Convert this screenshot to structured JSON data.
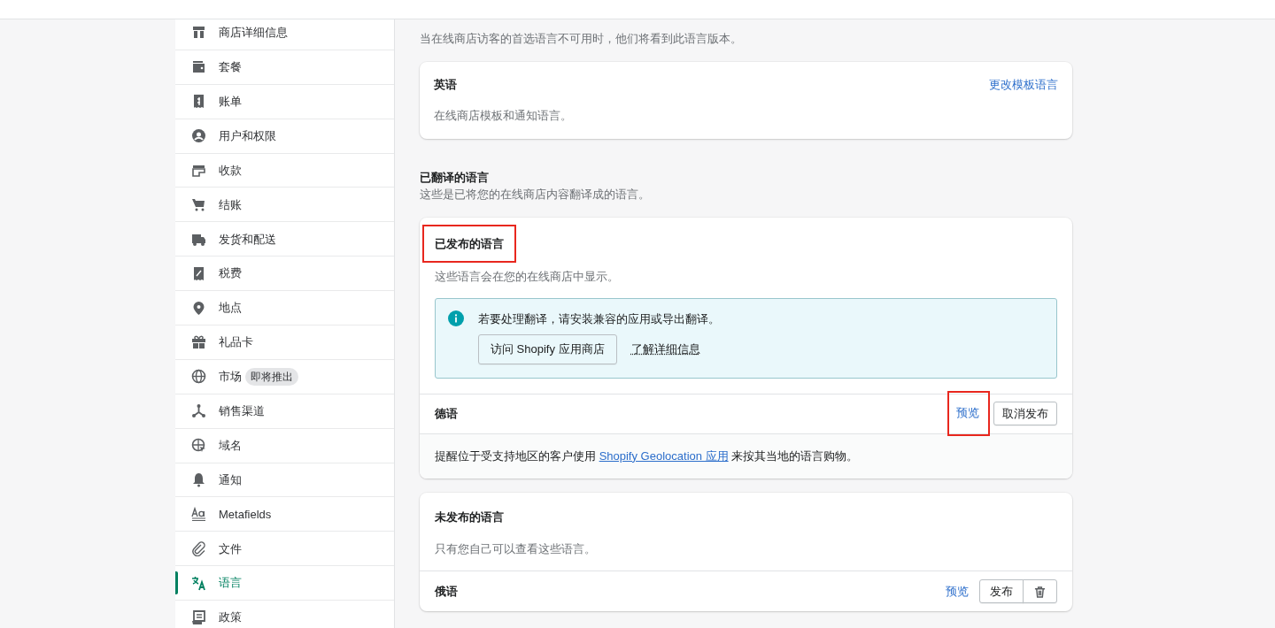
{
  "sidebar": {
    "items": [
      {
        "label": "商店详细信息",
        "selected": false
      },
      {
        "label": "套餐",
        "selected": false
      },
      {
        "label": "账单",
        "selected": false
      },
      {
        "label": "用户和权限",
        "selected": false
      },
      {
        "label": "收款",
        "selected": false
      },
      {
        "label": "结账",
        "selected": false
      },
      {
        "label": "发货和配送",
        "selected": false
      },
      {
        "label": "税费",
        "selected": false
      },
      {
        "label": "地点",
        "selected": false
      },
      {
        "label": "礼品卡",
        "selected": false
      },
      {
        "label": "市场",
        "selected": false,
        "badge": "即将推出"
      },
      {
        "label": "销售渠道",
        "selected": false
      },
      {
        "label": "域名",
        "selected": false
      },
      {
        "label": "通知",
        "selected": false
      },
      {
        "label": "Metafields",
        "selected": false
      },
      {
        "label": "文件",
        "selected": false
      },
      {
        "label": "语言",
        "selected": true
      },
      {
        "label": "政策",
        "selected": false
      }
    ]
  },
  "default_language": {
    "description": "当在线商店访客的首选语言不可用时，他们将看到此语言版本。",
    "card": {
      "name": "英语",
      "action": "更改模板语言",
      "note": "在线商店模板和通知语言。"
    }
  },
  "translated": {
    "title": "已翻译的语言",
    "description": "这些是已将您的在线商店内容翻译成的语言。",
    "published": {
      "title": "已发布的语言",
      "highlighted": true,
      "description": "这些语言会在您的在线商店中显示。",
      "banner": {
        "message": "若要处理翻译，请安装兼容的应用或导出翻译。",
        "button": "访问 Shopify 应用商店",
        "link": "了解详细信息"
      },
      "languages": [
        {
          "name": "德语",
          "preview": "预览",
          "preview_highlighted": true,
          "action": "取消发布",
          "note_before": "提醒位于受支持地区的客户使用 ",
          "note_link": "Shopify Geolocation 应用",
          "note_after": " 来按其当地的语言购物。"
        }
      ]
    },
    "unpublished": {
      "title": "未发布的语言",
      "description": "只有您自己可以查看这些语言。",
      "languages": [
        {
          "name": "俄语",
          "preview": "预览",
          "preview_highlighted": false,
          "action": "发布",
          "deletable": true
        }
      ]
    }
  }
}
